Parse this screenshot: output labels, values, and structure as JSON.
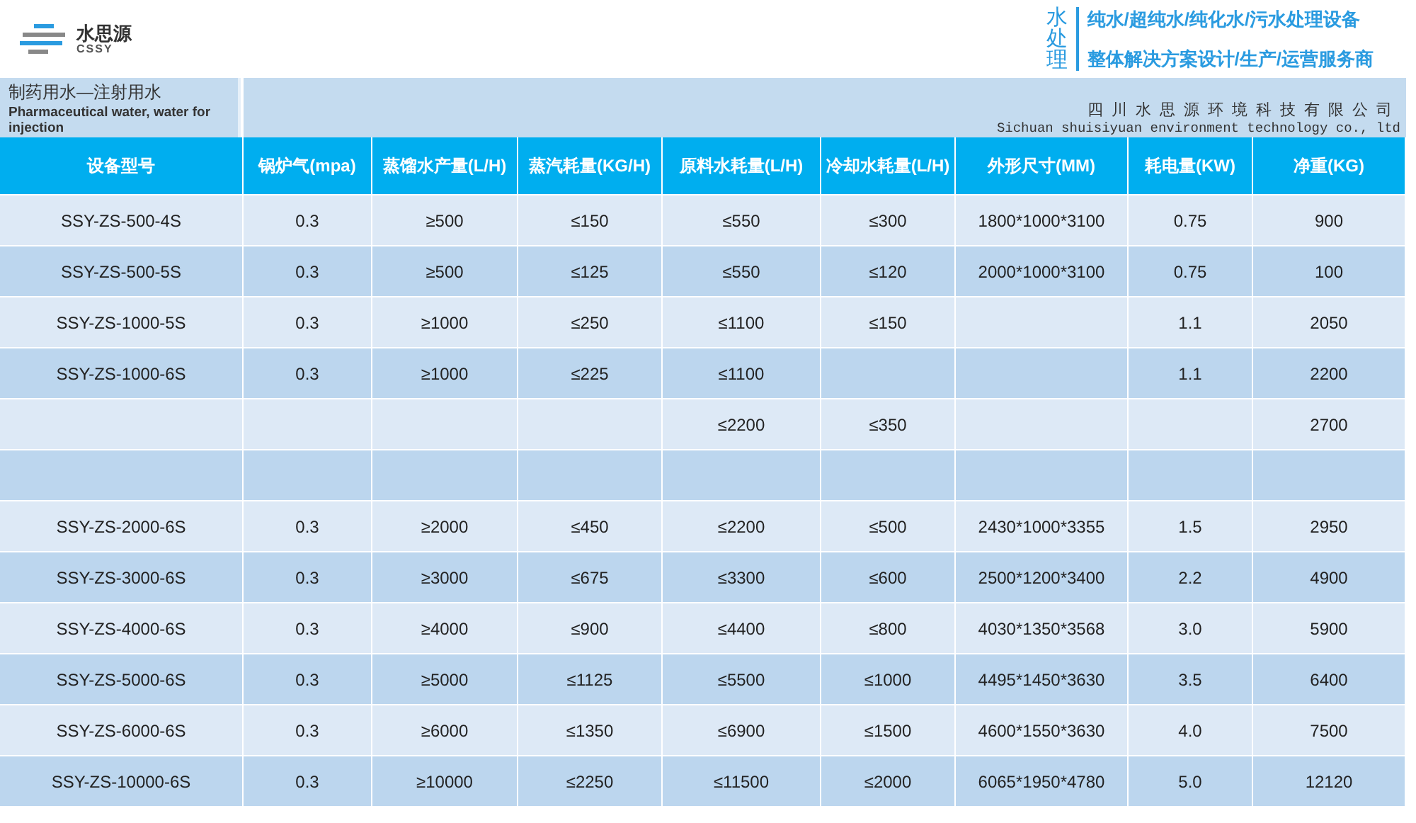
{
  "logo": {
    "name": "水思源",
    "sub": "CSSY"
  },
  "slogan": {
    "tag": "水处理",
    "lines": [
      "纯水/超纯水/纯化水/污水处理设备",
      "整体解决方案设计/生产/运营服务商"
    ]
  },
  "title": {
    "zh": "制药用水—注射用水",
    "en": "Pharmaceutical water, water for injection"
  },
  "company": {
    "zh": "四川水思源环境科技有限公司",
    "en": "Sichuan shuisiyuan environment technology co., ltd"
  },
  "table": {
    "columns": [
      "设备型号",
      "锅炉气(mpa)",
      "蒸馏水产量(L/H)",
      "蒸汽耗量(KG/H)",
      "原料水耗量(L/H)",
      "冷却水耗量(L/H)",
      "外形尺寸(MM)",
      "耗电量(KW)",
      "净重(KG)"
    ],
    "rows": [
      [
        "SSY-ZS-500-4S",
        "0.3",
        "≥500",
        "≤150",
        "≤550",
        "≤300",
        "1800*1000*3100",
        "0.75",
        "900"
      ],
      [
        "SSY-ZS-500-5S",
        "0.3",
        "≥500",
        "≤125",
        "≤550",
        "≤120",
        "2000*1000*3100",
        "0.75",
        "100"
      ],
      [
        "SSY-ZS-1000-5S",
        "0.3",
        "≥1000",
        "≤250",
        "≤1100",
        "≤150",
        null,
        "1.1",
        "2050"
      ],
      [
        "SSY-ZS-1000-6S",
        "0.3",
        "≥1000",
        "≤225",
        "≤1100",
        null,
        null,
        "1.1",
        "2200"
      ],
      [
        null,
        null,
        null,
        null,
        "≤2200",
        "≤350",
        null,
        null,
        "2700"
      ],
      [
        null,
        null,
        null,
        null,
        null,
        null,
        null,
        null,
        null
      ],
      [
        "SSY-ZS-2000-6S",
        "0.3",
        "≥2000",
        "≤450",
        "≤2200",
        "≤500",
        "2430*1000*3355",
        "1.5",
        "2950"
      ],
      [
        "SSY-ZS-3000-6S",
        "0.3",
        "≥3000",
        "≤675",
        "≤3300",
        "≤600",
        "2500*1200*3400",
        "2.2",
        "4900"
      ],
      [
        "SSY-ZS-4000-6S",
        "0.3",
        "≥4000",
        "≤900",
        "≤4400",
        "≤800",
        "4030*1350*3568",
        "3.0",
        "5900"
      ],
      [
        "SSY-ZS-5000-6S",
        "0.3",
        "≥5000",
        "≤1125",
        "≤5500",
        "≤1000",
        "4495*1450*3630",
        "3.5",
        "6400"
      ],
      [
        "SSY-ZS-6000-6S",
        "0.3",
        "≥6000",
        "≤1350",
        "≤6900",
        "≤1500",
        "4600*1550*3630",
        "4.0",
        "7500"
      ],
      [
        "SSY-ZS-10000-6S",
        "0.3",
        "≥10000",
        "≤2250",
        "≤11500",
        "≤2000",
        "6065*1950*4780",
        "5.0",
        "12120"
      ]
    ]
  }
}
